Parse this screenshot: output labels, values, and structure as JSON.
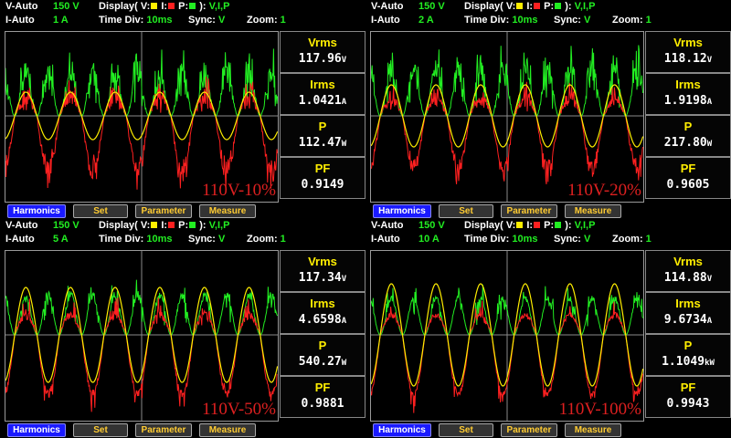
{
  "colors": {
    "voltage": "#ffee00",
    "current": "#ff2020",
    "power": "#22ee22"
  },
  "panels": [
    {
      "v_mode": "V-Auto",
      "v_range": "150 V",
      "i_mode": "I-Auto",
      "i_range": "1 A",
      "display_label": "Display(",
      "v_label": "V:",
      "i_label": "I:",
      "p_label": "P:",
      "display_close": "):",
      "display_value": "V,I,P",
      "time_div_label": "Time Div:",
      "time_div": "10ms",
      "sync_label": "Sync:",
      "sync": "V",
      "zoom_label": "Zoom:",
      "zoom": "1",
      "vrms_label": "Vrms",
      "vrms": "117.96",
      "vrms_unit": "V",
      "irms_label": "Irms",
      "irms": "1.0421",
      "irms_unit": "A",
      "p_name": "P",
      "p": "112.47",
      "p_unit": "W",
      "pf_label": "PF",
      "pf": "0.9149",
      "watermark": "110V-10%",
      "buttons": [
        "Harmonics",
        "Set",
        "Parameter",
        "Measure"
      ]
    },
    {
      "v_mode": "V-Auto",
      "v_range": "150 V",
      "i_mode": "I-Auto",
      "i_range": "2 A",
      "display_label": "Display(",
      "v_label": "V:",
      "i_label": "I:",
      "p_label": "P:",
      "display_close": "):",
      "display_value": "V,I,P",
      "time_div_label": "Time Div:",
      "time_div": "10ms",
      "sync_label": "Sync:",
      "sync": "V",
      "zoom_label": "Zoom:",
      "zoom": "1",
      "vrms_label": "Vrms",
      "vrms": "118.12",
      "vrms_unit": "V",
      "irms_label": "Irms",
      "irms": "1.9198",
      "irms_unit": "A",
      "p_name": "P",
      "p": "217.80",
      "p_unit": "W",
      "pf_label": "PF",
      "pf": "0.9605",
      "watermark": "110V-20%",
      "buttons": [
        "Harmonics",
        "Set",
        "Parameter",
        "Measure"
      ]
    },
    {
      "v_mode": "V-Auto",
      "v_range": "150 V",
      "i_mode": "I-Auto",
      "i_range": "5 A",
      "display_label": "Display(",
      "v_label": "V:",
      "i_label": "I:",
      "p_label": "P:",
      "display_close": "):",
      "display_value": "V,I,P",
      "time_div_label": "Time Div:",
      "time_div": "10ms",
      "sync_label": "Sync:",
      "sync": "V",
      "zoom_label": "Zoom:",
      "zoom": "1",
      "vrms_label": "Vrms",
      "vrms": "117.34",
      "vrms_unit": "V",
      "irms_label": "Irms",
      "irms": "4.6598",
      "irms_unit": "A",
      "p_name": "P",
      "p": "540.27",
      "p_unit": "W",
      "pf_label": "PF",
      "pf": "0.9881",
      "watermark": "110V-50%",
      "buttons": [
        "Harmonics",
        "Set",
        "Parameter",
        "Measure"
      ]
    },
    {
      "v_mode": "V-Auto",
      "v_range": "150 V",
      "i_mode": "I-Auto",
      "i_range": "10 A",
      "display_label": "Display(",
      "v_label": "V:",
      "i_label": "I:",
      "p_label": "P:",
      "display_close": "):",
      "display_value": "V,I,P",
      "time_div_label": "Time Div:",
      "time_div": "10ms",
      "sync_label": "Sync:",
      "sync": "V",
      "zoom_label": "Zoom:",
      "zoom": "1",
      "vrms_label": "Vrms",
      "vrms": "114.88",
      "vrms_unit": "V",
      "irms_label": "Irms",
      "irms": "9.6734",
      "irms_unit": "A",
      "p_name": "P",
      "p": "1.1049",
      "p_unit": "kW",
      "pf_label": "PF",
      "pf": "0.9943",
      "watermark": "110V-100%",
      "buttons": [
        "Harmonics",
        "Set",
        "Parameter",
        "Measure"
      ]
    }
  ]
}
